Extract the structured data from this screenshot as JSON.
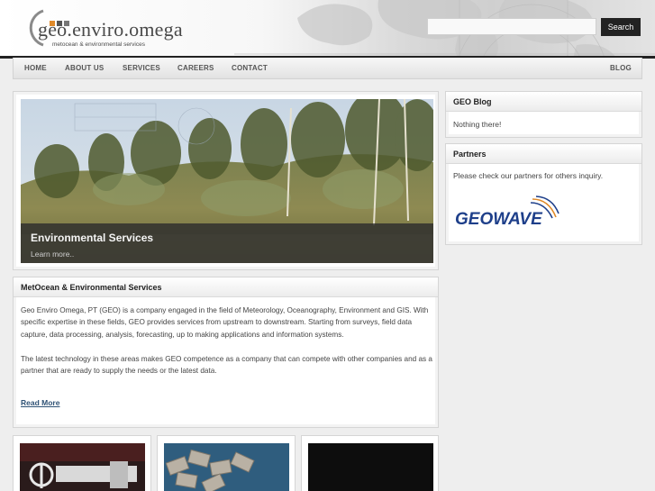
{
  "header": {
    "logo_title": "geo.enviro.omega",
    "logo_subtitle": "metocean & environmental services",
    "search": {
      "placeholder": "",
      "button_label": "Search"
    }
  },
  "nav": {
    "items": [
      "HOME",
      "ABOUT US",
      "SERVICES",
      "CAREERS",
      "CONTACT"
    ],
    "blog": "BLOG"
  },
  "hero": {
    "title": "Environmental Services",
    "link": "Learn more.."
  },
  "about": {
    "heading": "MetOcean & Environmental Services",
    "paragraph1": "Geo Enviro Omega, PT (GEO) is a company engaged in the field of Meteorology, Oceanography, Environment and GIS. With specific expertise in these fields, GEO provides services from upstream to downstream. Starting from surveys, field data capture, data processing, analysis, forecasting, up to making applications and information systems.",
    "paragraph2": "The latest technology in these areas makes GEO competence as a company that can compete with other companies and as a partner that are ready to supply the needs or the latest data.",
    "read_more": "Read More"
  },
  "sidebar": {
    "blog_heading": "GEO Blog",
    "blog_text": "Nothing there!",
    "partners_heading": "Partners",
    "partners_text": "Please check our partners for others inquiry.",
    "partner_logo_text": "GEOWAVE"
  },
  "colors": {
    "accent_dark": "#222222",
    "link": "#2f5275",
    "logo_dot_1": "#e08a2a",
    "logo_dot_2": "#555555",
    "logo_dot_3": "#777777",
    "geowave_blue": "#1e3f8a",
    "geowave_orange": "#e08a2a"
  }
}
